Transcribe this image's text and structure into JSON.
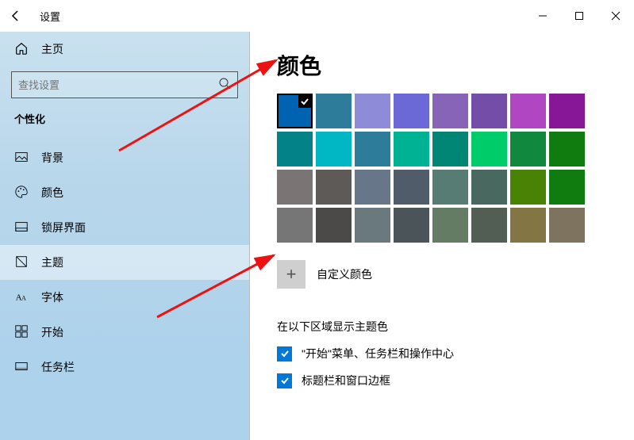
{
  "titlebar": {
    "app_title": "设置"
  },
  "sidebar": {
    "home_label": "主页",
    "search_placeholder": "查找设置",
    "category_label": "个性化",
    "items": [
      {
        "label": "背景"
      },
      {
        "label": "颜色"
      },
      {
        "label": "锁屏界面"
      },
      {
        "label": "主题"
      },
      {
        "label": "字体"
      },
      {
        "label": "开始"
      },
      {
        "label": "任务栏"
      }
    ]
  },
  "main": {
    "heading": "颜色",
    "custom_color_label": "自定义颜色",
    "section_label": "在以下区域显示主题色",
    "options": [
      {
        "label": "\"开始\"菜单、任务栏和操作中心"
      },
      {
        "label": "标题栏和窗口边框"
      }
    ],
    "palette": [
      "#0063b1",
      "#2d7d9a",
      "#8e8cd8",
      "#6b69d6",
      "#8764b8",
      "#744da9",
      "#b146c2",
      "#881798",
      "#038387",
      "#00b7c3",
      "#2d7d9a",
      "#00b294",
      "#018574",
      "#00cc6a",
      "#10893e",
      "#107c10",
      "#7a7574",
      "#5d5a58",
      "#68768a",
      "#515c6b",
      "#567c73",
      "#486860",
      "#498205",
      "#107c10",
      "#767676",
      "#4c4a48",
      "#69797e",
      "#4a5459",
      "#647c64",
      "#525e54",
      "#847545",
      "#7e735f"
    ]
  }
}
